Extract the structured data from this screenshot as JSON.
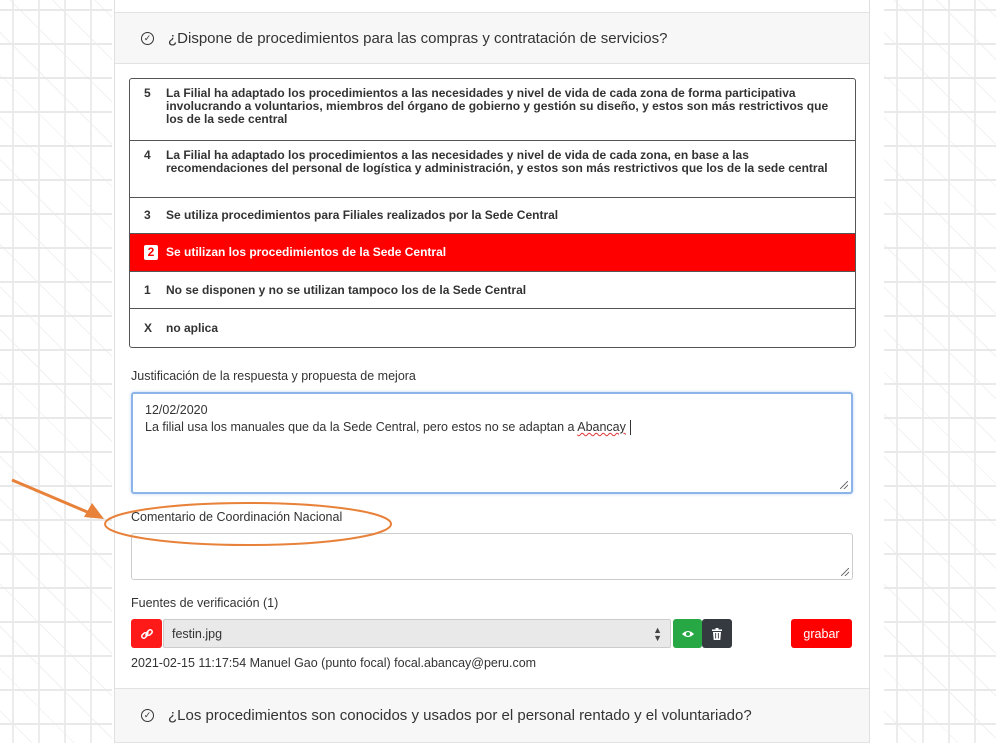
{
  "question1": {
    "text": "¿Dispone de procedimientos para las compras y contratación de servicios?",
    "options": [
      {
        "num": "5",
        "text": "La Filial ha adaptado los procedimientos a las necesidades y nivel de vida de cada zona de forma participativa involucrando a voluntarios, miembros del órgano de gobierno y gestión su diseño, y estos son más restrictivos que los de la sede central"
      },
      {
        "num": "4",
        "text": "La Filial ha adaptado los procedimientos a las necesidades y nivel de vida de cada zona, en base a las recomendaciones del personal de logística y administración, y estos son más restrictivos que los de la sede central"
      },
      {
        "num": "3",
        "text": "Se utiliza procedimientos para Filiales realizados por la Sede Central"
      },
      {
        "num": "2",
        "text": "Se utilizan los procedimientos de la Sede Central",
        "selected": true
      },
      {
        "num": "1",
        "text": "No se disponen y no se utilizan tampoco los de la Sede Central"
      },
      {
        "num": "X",
        "text": "no aplica"
      }
    ]
  },
  "justification": {
    "label": "Justificación de la respuesta y propuesta de mejora",
    "date": "12/02/2020",
    "text_before": "La filial usa los manuales que da la Sede Central, pero estos no se adaptan a ",
    "text_misspelled": "Abancay"
  },
  "comment": {
    "label": "Comentario de Coordinación Nacional",
    "value": ""
  },
  "sources": {
    "label": "Fuentes de verificación (1)",
    "selected_file": "festin.jpg",
    "save_label": "grabar",
    "meta": "2021-02-15 11:17:54 Manuel Gao (punto focal) focal.abancay@peru.com"
  },
  "question2": {
    "text": "¿Los procedimientos son conocidos y usados por el personal rentado y el voluntariado?"
  },
  "colors": {
    "selected": "#ff0000",
    "view_button": "#28a745",
    "delete_button": "#343a40",
    "annotation": "#e8823a"
  },
  "icons": {
    "question": "check-circle-icon",
    "link": "link-icon",
    "view": "eye-icon",
    "delete": "trash-icon"
  }
}
